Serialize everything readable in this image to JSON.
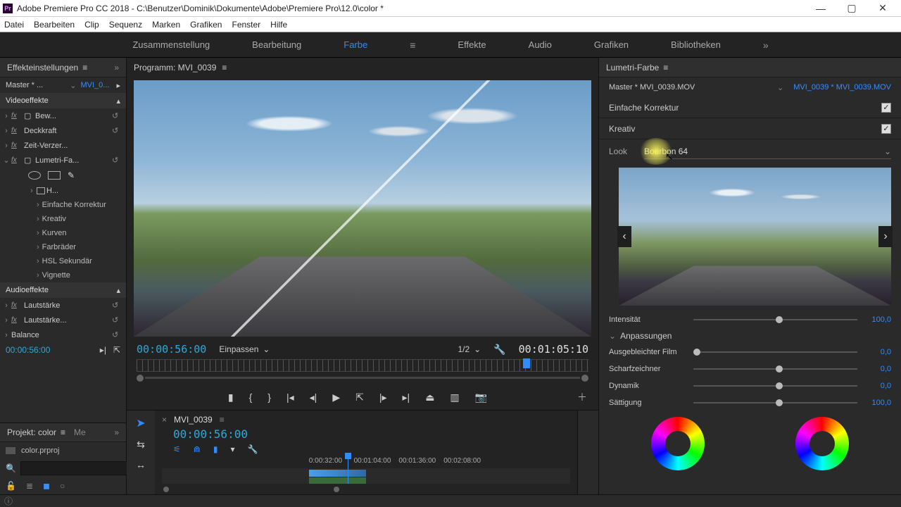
{
  "window": {
    "title": "Adobe Premiere Pro CC 2018 - C:\\Benutzer\\Dominik\\Dokumente\\Adobe\\Premiere Pro\\12.0\\color *",
    "logo": "Pr"
  },
  "menu": [
    "Datei",
    "Bearbeiten",
    "Clip",
    "Sequenz",
    "Marken",
    "Grafiken",
    "Fenster",
    "Hilfe"
  ],
  "workspaces": {
    "items": [
      "Zusammenstellung",
      "Bearbeitung",
      "Farbe",
      "Effekte",
      "Audio",
      "Grafiken",
      "Bibliotheken"
    ],
    "active": "Farbe"
  },
  "effect_controls": {
    "title": "Effekteinstellungen",
    "master": "Master * ...",
    "clip_link": "MVI_0...",
    "video_header": "Videoeffekte",
    "fx": [
      {
        "label": "Bew..."
      },
      {
        "label": "Deckkraft"
      },
      {
        "label": "Zeit-Verzer..."
      },
      {
        "label": "Lumetri-Fa..."
      }
    ],
    "mask_row": "H...",
    "lumetri_children": [
      "Einfache Korrektur",
      "Kreativ",
      "Kurven",
      "Farbräder",
      "HSL Sekundär",
      "Vignette"
    ],
    "audio_header": "Audioeffekte",
    "audio_fx": [
      {
        "label": "Lautstärke"
      },
      {
        "label": "Lautstärke..."
      },
      {
        "label": "Balance"
      }
    ],
    "timecode": "00:00:56:00"
  },
  "project": {
    "title": "Projekt: color",
    "other_tab": "Me",
    "file": "color.prproj",
    "search_placeholder": ""
  },
  "program": {
    "title": "Programm: MVI_0039",
    "current_tc": "00:00:56:00",
    "fit": "Einpassen",
    "zoom": "1/2",
    "duration": "00:01:05:10"
  },
  "timeline": {
    "sequence": "MVI_0039",
    "timecode": "00:00:56:00",
    "ruler": [
      {
        "t": "0:00:32:00",
        "pos": 36
      },
      {
        "t": "00:01:04:00",
        "pos": 47
      },
      {
        "t": "00:01:36:00",
        "pos": 58
      },
      {
        "t": "00:02:08:00",
        "pos": 69
      }
    ]
  },
  "lumetri": {
    "title": "Lumetri-Farbe",
    "master": "Master * MVI_0039.MOV",
    "clip_link": "MVI_0039 * MVI_0039.MOV",
    "sections": {
      "basic": "Einfache Korrektur",
      "creative": "Kreativ"
    },
    "look_label": "Look",
    "look_value": "Bourbon 64",
    "sliders": {
      "intensity": {
        "label": "Intensität",
        "value": "100,0",
        "pos": 50
      },
      "adjust_header": "Anpassungen",
      "faded": {
        "label": "Ausgebleichter Film",
        "value": "0,0",
        "pos": 0
      },
      "sharpen": {
        "label": "Scharfzeichner",
        "value": "0,0",
        "pos": 50
      },
      "vibrance": {
        "label": "Dynamik",
        "value": "0,0",
        "pos": 50
      },
      "saturation": {
        "label": "Sättigung",
        "value": "100,0",
        "pos": 50
      }
    }
  }
}
